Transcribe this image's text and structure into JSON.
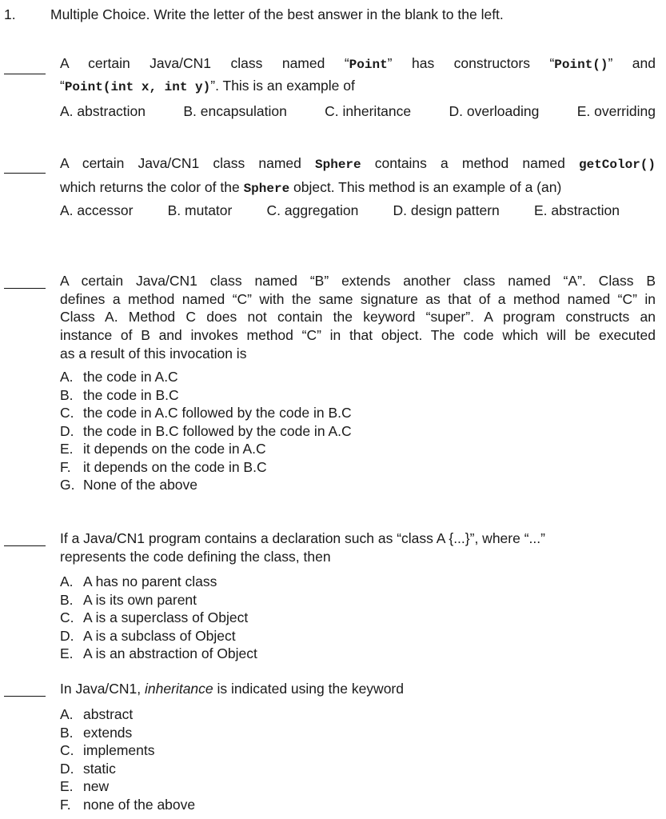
{
  "header": {
    "number": "1.",
    "instruction": "Multiple Choice. Write the letter of the best answer in the blank to the left."
  },
  "questions": [
    {
      "id": 1,
      "stem_line1": [
        "A certain Java/CN1 class named “",
        "Point",
        "” has constructors “",
        "Point()",
        "” and"
      ],
      "stem_line2": [
        "“",
        "Point(int x, int y)",
        "”. This is an example of"
      ],
      "options": [
        {
          "letter": "A.",
          "text": "abstraction"
        },
        {
          "letter": "B.",
          "text": "encapsulation"
        },
        {
          "letter": "C.",
          "text": "inheritance"
        },
        {
          "letter": "D.",
          "text": "overloading"
        },
        {
          "letter": "E.",
          "text": "overriding"
        }
      ]
    },
    {
      "id": 2,
      "stem_line1": [
        "A certain Java/CN1 class named ",
        "Sphere",
        " contains a method named ",
        "getColor()"
      ],
      "stem_line2": [
        "which returns the color of the ",
        "Sphere",
        " object. This method is an example of a (an)"
      ],
      "options": [
        {
          "letter": "A.",
          "text": "accessor"
        },
        {
          "letter": "B.",
          "text": "mutator"
        },
        {
          "letter": "C.",
          "text": "aggregation"
        },
        {
          "letter": "D.",
          "text": "design pattern"
        },
        {
          "letter": "E.",
          "text": "abstraction"
        }
      ]
    },
    {
      "id": 3,
      "stem": "A certain Java/CN1 class named “B” extends another class named “A”. Class B defines a method named “C” with the same signature as that of a method named “C” in Class A. Method C does not contain the keyword “super”. A program constructs an instance of B and invokes method “C” in that object. The code which will be executed as a result of this invocation is",
      "stem_lines": [
        "A certain Java/CN1 class named “B” extends another class named “A”. Class B",
        "defines a method named “C” with the same signature as that of a method named “C” in",
        "Class A. Method C does not contain the keyword “super”. A program constructs an",
        "instance of B and invokes method “C” in that object. The code which will be executed",
        "as a result of this invocation is"
      ],
      "options": [
        {
          "letter": "A.",
          "text": "the code in A.C"
        },
        {
          "letter": "B.",
          "text": "the code in B.C"
        },
        {
          "letter": "C.",
          "text": "the code in A.C followed by the code in B.C"
        },
        {
          "letter": "D.",
          "text": "the code in B.C followed by the code in A.C"
        },
        {
          "letter": "E.",
          "text": "it depends on the code in A.C"
        },
        {
          "letter": "F.",
          "text": "it depends on the code in B.C"
        },
        {
          "letter": "G.",
          "text": "None of the above"
        }
      ]
    },
    {
      "id": 4,
      "stem_lines": [
        "If a Java/CN1 program contains a declaration such as “class A {...}”, where “...”",
        "represents the code defining the class, then"
      ],
      "options": [
        {
          "letter": "A.",
          "text": "A has no parent class"
        },
        {
          "letter": "B.",
          "text": "A is its own parent"
        },
        {
          "letter": "C.",
          "text": "A is a superclass of Object"
        },
        {
          "letter": "D.",
          "text": "A is a subclass of Object"
        },
        {
          "letter": "E.",
          "text": "A is an abstraction of Object"
        }
      ]
    },
    {
      "id": 5,
      "stem_parts": [
        "In Java/CN1, ",
        "inheritance",
        " is indicated using the keyword"
      ],
      "options": [
        {
          "letter": "A.",
          "text": "abstract"
        },
        {
          "letter": "B.",
          "text": "extends"
        },
        {
          "letter": "C.",
          "text": "implements"
        },
        {
          "letter": "D.",
          "text": "static"
        },
        {
          "letter": "E.",
          "text": "new"
        },
        {
          "letter": "F.",
          "text": "none of the above"
        }
      ]
    }
  ]
}
